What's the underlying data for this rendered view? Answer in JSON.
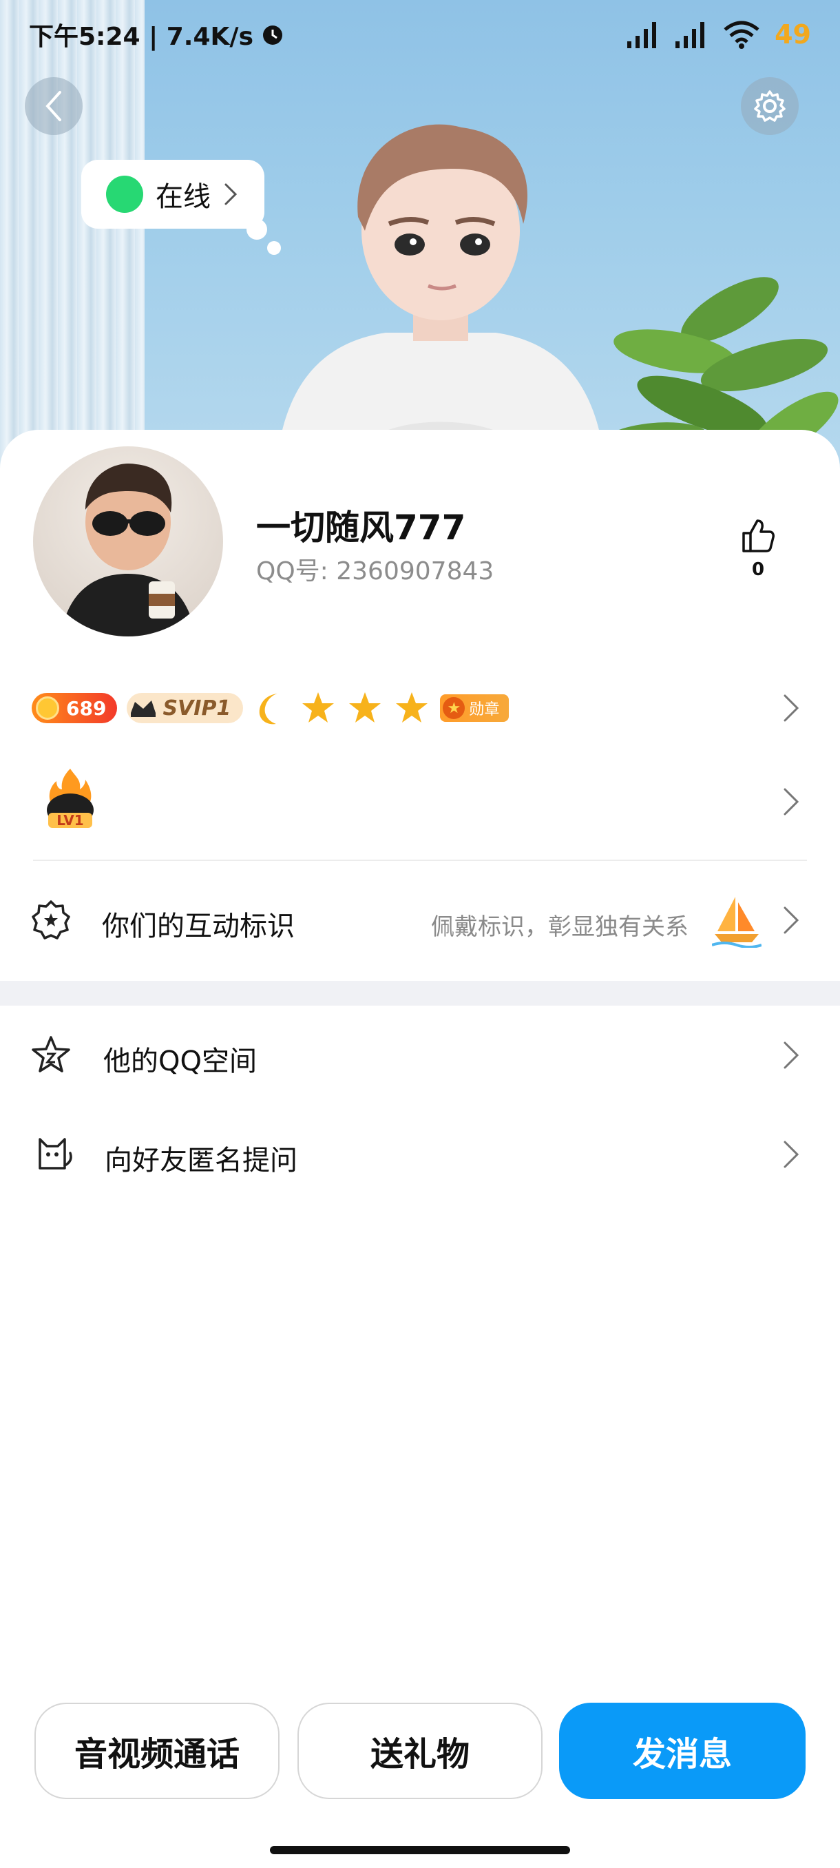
{
  "status_bar": {
    "time_speed": "下午5:24 | 7.4K/s",
    "battery": "49"
  },
  "header": {
    "online_status": "在线"
  },
  "profile": {
    "nickname": "一切随风777",
    "qq_number": "QQ号: 2360907843",
    "like_count": "0"
  },
  "badges": {
    "level": "689",
    "svip": "SVIP1",
    "medal": "勋章",
    "lv": "LV1"
  },
  "rows": {
    "interaction_mark_label": "你们的互动标识",
    "interaction_mark_hint": "佩戴标识，彰显独有关系",
    "qzone_label": "他的QQ空间",
    "anon_question_label": "向好友匿名提问"
  },
  "actions": {
    "call": "音视频通话",
    "gift": "送礼物",
    "message": "发消息"
  },
  "colors": {
    "primary": "#0a9af8",
    "online": "#27d873",
    "battery": "#f2a81d"
  }
}
